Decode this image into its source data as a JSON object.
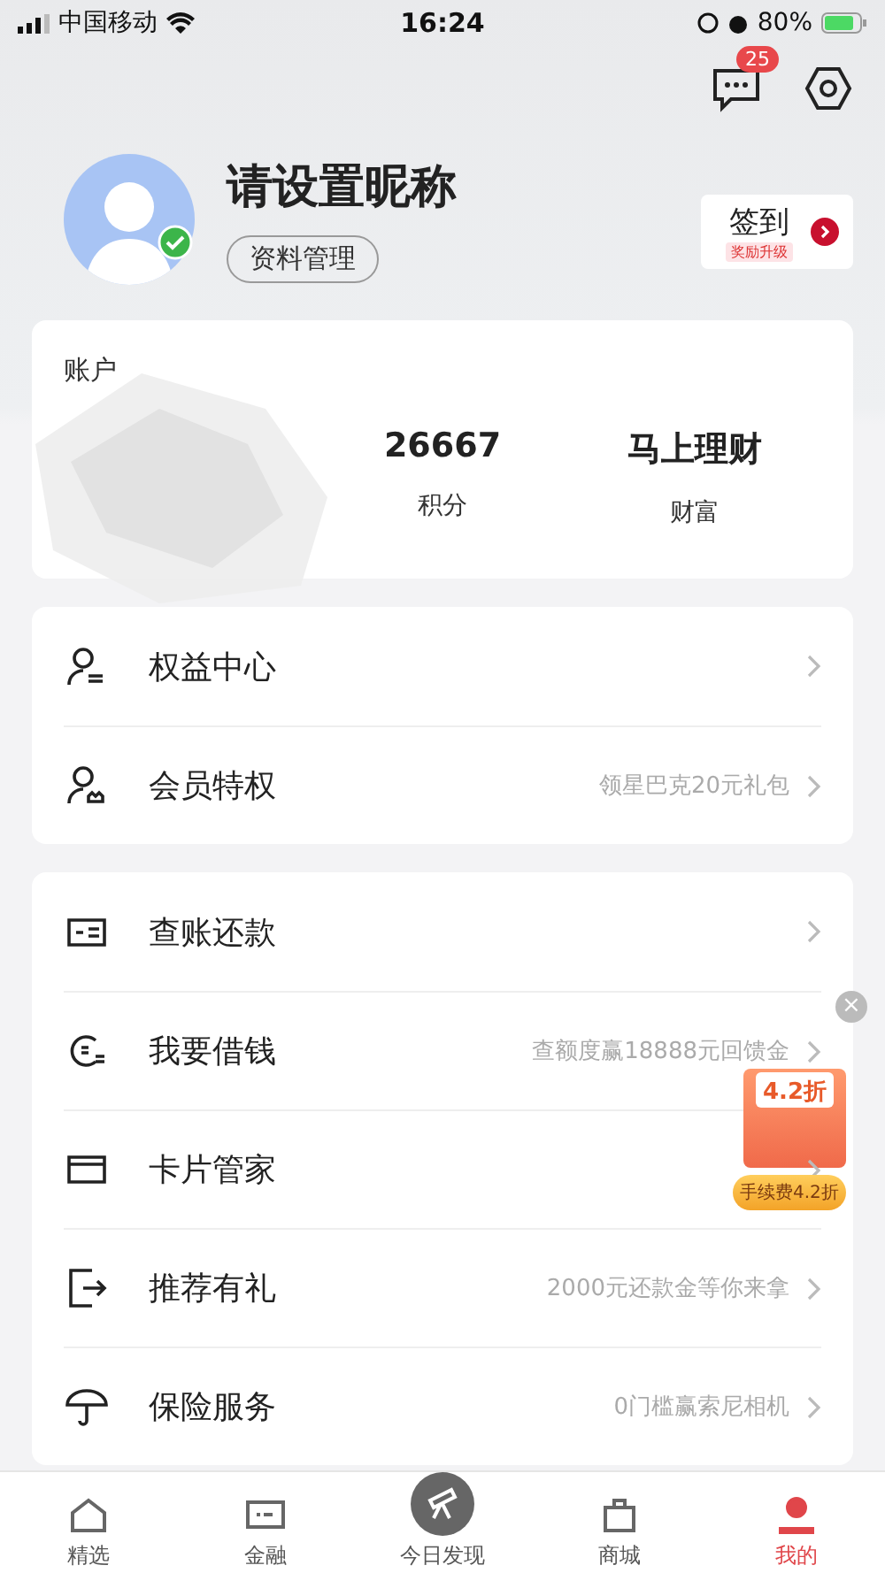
{
  "status_bar": {
    "carrier": "中国移动",
    "time": "16:24",
    "battery": "80%"
  },
  "header": {
    "message_badge": "25",
    "nickname": "请设置昵称",
    "profile_button": "资料管理",
    "checkin": {
      "label": "签到",
      "sub": "奖励升级"
    }
  },
  "account": {
    "title": "账户",
    "stats": [
      {
        "value": "26667",
        "label": "积分"
      },
      {
        "value": "马上理财",
        "label": "财富"
      }
    ]
  },
  "sections": [
    [
      {
        "label": "权益中心"
      },
      {
        "label": "会员特权",
        "hint": "领星巴克20元礼包"
      }
    ],
    [
      {
        "label": "查账还款"
      },
      {
        "label": "我要借钱",
        "hint": "查额度赢18888元回馈金"
      },
      {
        "label": "卡片管家"
      },
      {
        "label": "推荐有礼",
        "hint": "2000元还款金等你来拿"
      },
      {
        "label": "保险服务",
        "hint": "0门槛赢索尼相机"
      }
    ]
  ],
  "promo": {
    "close": "×",
    "discount": "4.2折",
    "ribbon": "手续费4.2折"
  },
  "tabs": [
    {
      "label": "精选",
      "selected": false
    },
    {
      "label": "金融",
      "selected": false
    },
    {
      "label": "今日发现",
      "selected": false
    },
    {
      "label": "商城",
      "selected": false
    },
    {
      "label": "我的",
      "selected": true
    }
  ]
}
